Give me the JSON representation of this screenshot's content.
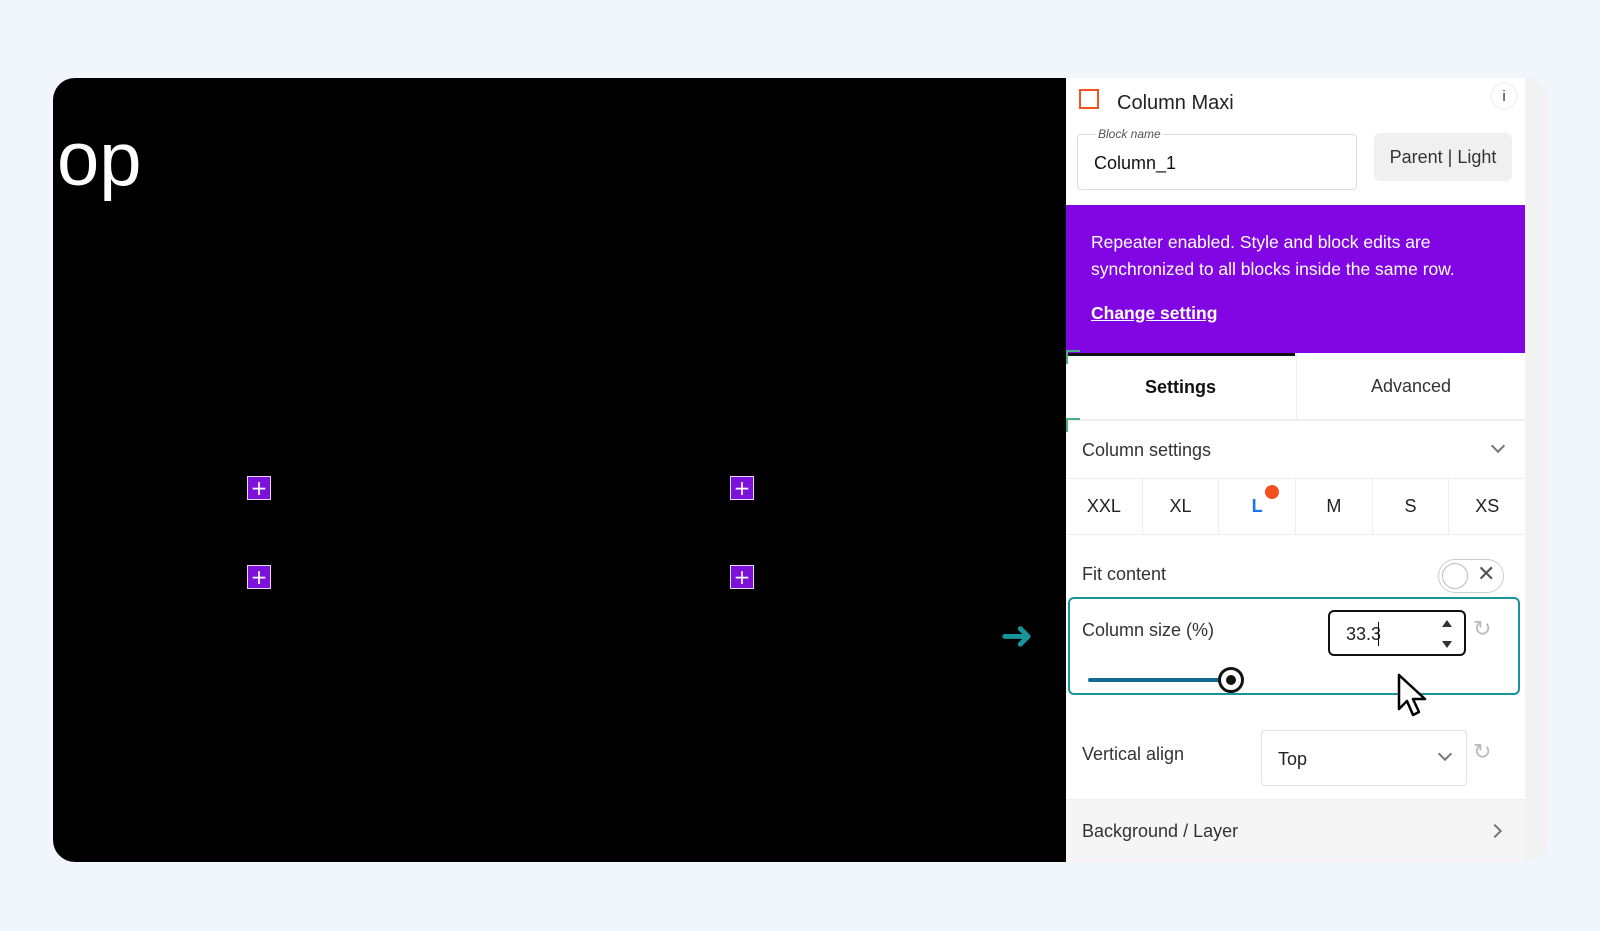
{
  "canvas": {
    "text": "op",
    "add_button_label": "+"
  },
  "panel": {
    "title": "Column Maxi",
    "info_label": "i",
    "block_name": {
      "label": "Block name",
      "value": "Column_1"
    },
    "parent_button": "Parent | Light",
    "banner": {
      "text": "Repeater enabled. Style and block edits are synchronized to all blocks inside the same row.",
      "link": "Change setting"
    },
    "tabs": {
      "settings": "Settings",
      "advanced": "Advanced"
    },
    "section_title": "Column settings",
    "breakpoints": [
      "XXL",
      "XL",
      "L",
      "M",
      "S",
      "XS"
    ],
    "active_breakpoint": "L",
    "fit_content": {
      "label": "Fit content",
      "enabled": false
    },
    "column_size": {
      "label": "Column size (%)",
      "value": "33.3",
      "slider_percent": 33.3
    },
    "vertical_align": {
      "label": "Vertical align",
      "value": "Top"
    },
    "background_layer": "Background / Layer"
  },
  "colors": {
    "banner": "#8106e3",
    "accent_teal": "#18949c",
    "active_breakpoint": "#1a73e8",
    "dot": "#f4511e",
    "add_button": "#7c12d9"
  }
}
